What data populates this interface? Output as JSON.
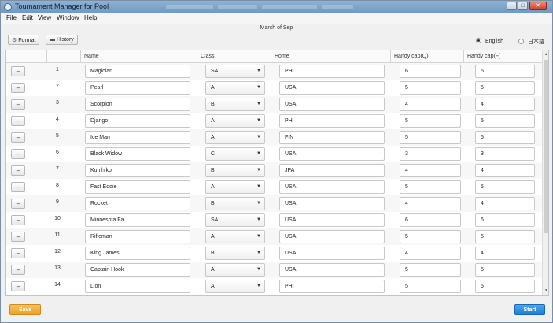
{
  "window": {
    "title": "Tournament Manager for Pool",
    "controls": {
      "minimize": "–",
      "maximize": "□",
      "close": "✕"
    }
  },
  "menu": [
    "File",
    "Edit",
    "View",
    "Window",
    "Help"
  ],
  "event_name": "March of Sep",
  "toolbar": {
    "format_label": "Format",
    "history_label": "History"
  },
  "language": {
    "english": "English",
    "japanese": "日本語",
    "selected": "English"
  },
  "columns": {
    "name": "Name",
    "class": "Class",
    "home": "Home",
    "handicap_q": "Handy cap(Q)",
    "handicap_f": "Handy cap(F)"
  },
  "remove_label": "–",
  "players": [
    {
      "no": "1",
      "name": "Magician",
      "class": "SA",
      "home": "PHI",
      "hq": "6",
      "hf": "6"
    },
    {
      "no": "2",
      "name": "Pearl",
      "class": "A",
      "home": "USA",
      "hq": "5",
      "hf": "5"
    },
    {
      "no": "3",
      "name": "Scorpion",
      "class": "B",
      "home": "USA",
      "hq": "4",
      "hf": "4"
    },
    {
      "no": "4",
      "name": "Django",
      "class": "A",
      "home": "PHI",
      "hq": "5",
      "hf": "5"
    },
    {
      "no": "5",
      "name": "Ice Man",
      "class": "A",
      "home": "FIN",
      "hq": "5",
      "hf": "5"
    },
    {
      "no": "6",
      "name": "Black Widow",
      "class": "C",
      "home": "USA",
      "hq": "3",
      "hf": "3"
    },
    {
      "no": "7",
      "name": "Kunihiko",
      "class": "B",
      "home": "JPA",
      "hq": "4",
      "hf": "4"
    },
    {
      "no": "8",
      "name": "Fast Eddie",
      "class": "A",
      "home": "USA",
      "hq": "5",
      "hf": "5"
    },
    {
      "no": "9",
      "name": "Rocket",
      "class": "B",
      "home": "USA",
      "hq": "4",
      "hf": "4"
    },
    {
      "no": "10",
      "name": "Minnesota Fa",
      "class": "SA",
      "home": "USA",
      "hq": "6",
      "hf": "6"
    },
    {
      "no": "11",
      "name": "Rifleman",
      "class": "A",
      "home": "USA",
      "hq": "5",
      "hf": "5"
    },
    {
      "no": "12",
      "name": "King James",
      "class": "B",
      "home": "USA",
      "hq": "4",
      "hf": "4"
    },
    {
      "no": "13",
      "name": "Captain Hook",
      "class": "A",
      "home": "USA",
      "hq": "5",
      "hf": "5"
    },
    {
      "no": "14",
      "name": "Lion",
      "class": "A",
      "home": "PHI",
      "hq": "5",
      "hf": "5"
    }
  ],
  "actions": {
    "save": "Save",
    "start": "Start"
  },
  "colors": {
    "save": "#e9a12a",
    "start": "#1c7fd6"
  }
}
